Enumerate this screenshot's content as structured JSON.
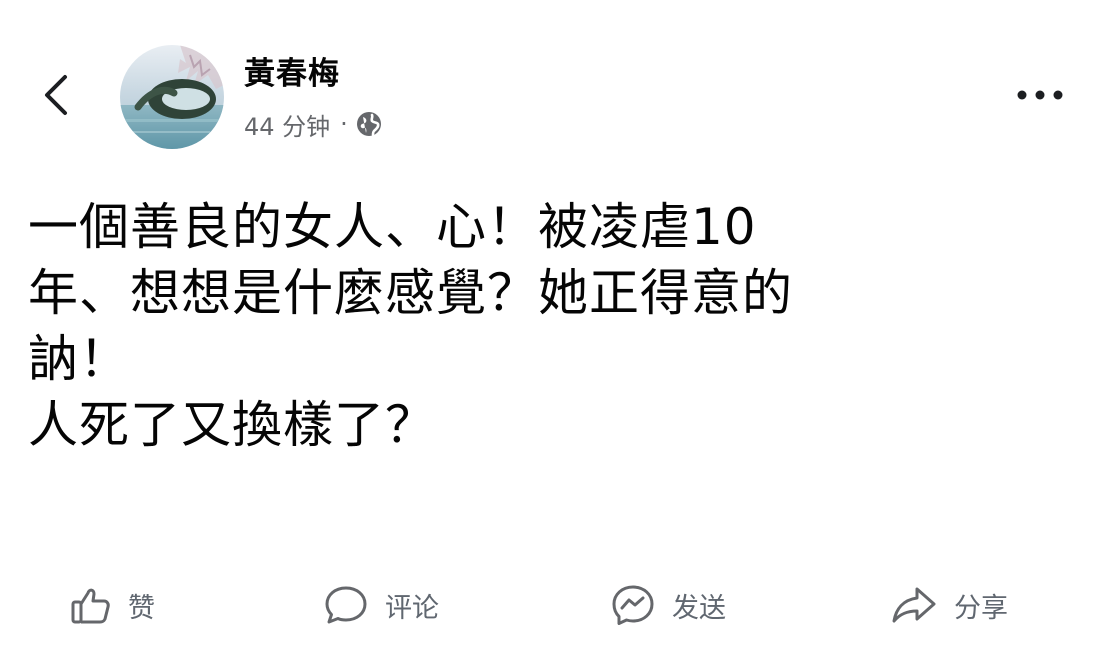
{
  "post": {
    "author": "黃春梅",
    "time": "44 分钟",
    "separator": "·",
    "privacy_icon": "globe-icon",
    "body_lines": [
      "一個善良的女人、心！被凌虐10",
      "年、想想是什麼感覺？她正得意的",
      "訥！",
      "人死了又換樣了？"
    ]
  },
  "actions": {
    "like_label": "赞",
    "comment_label": "评论",
    "send_label": "发送",
    "share_label": "分享"
  },
  "icons": {
    "back": "chevron-left-icon",
    "more": "more-horizontal-icon",
    "like": "thumbs-up-icon",
    "comment": "comment-icon",
    "send": "messenger-icon",
    "share": "share-arrow-icon"
  },
  "colors": {
    "text": "#050505",
    "secondary": "#65676b",
    "background": "#ffffff"
  }
}
